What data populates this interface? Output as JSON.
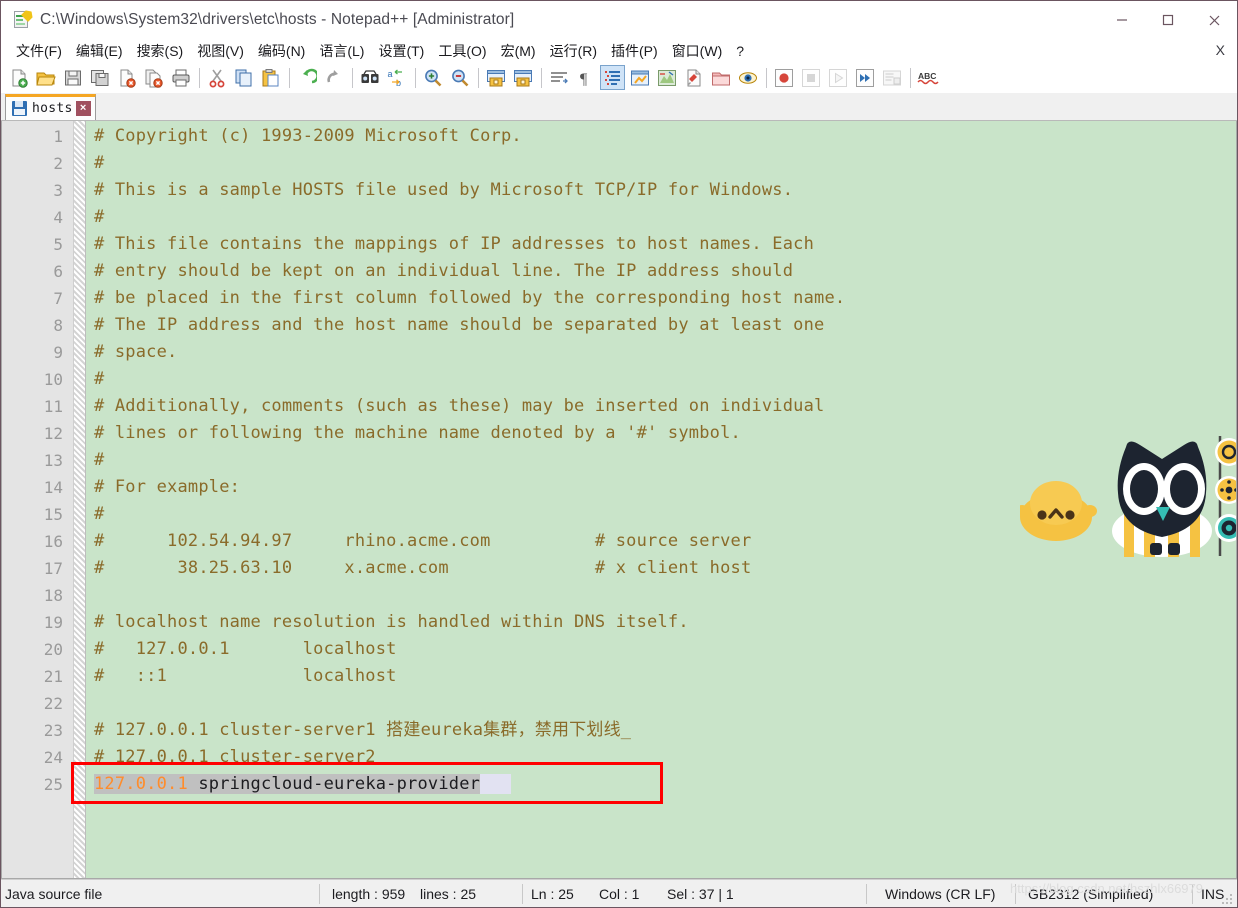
{
  "window": {
    "title": "C:\\Windows\\System32\\drivers\\etc\\hosts - Notepad++ [Administrator]",
    "app_icon": "notepad-plus-plus-icon",
    "controls": {
      "minimize": "minimize-icon",
      "maximize": "maximize-icon",
      "close": "close-icon"
    }
  },
  "menu": {
    "items": [
      {
        "label": "文件(F)",
        "name": "menu-file"
      },
      {
        "label": "编辑(E)",
        "name": "menu-edit"
      },
      {
        "label": "搜索(S)",
        "name": "menu-search"
      },
      {
        "label": "视图(V)",
        "name": "menu-view"
      },
      {
        "label": "编码(N)",
        "name": "menu-encoding"
      },
      {
        "label": "语言(L)",
        "name": "menu-language"
      },
      {
        "label": "设置(T)",
        "name": "menu-settings"
      },
      {
        "label": "工具(O)",
        "name": "menu-tools"
      },
      {
        "label": "宏(M)",
        "name": "menu-macro"
      },
      {
        "label": "运行(R)",
        "name": "menu-run"
      },
      {
        "label": "插件(P)",
        "name": "menu-plugins"
      },
      {
        "label": "窗口(W)",
        "name": "menu-window"
      },
      {
        "label": "?",
        "name": "menu-help"
      }
    ],
    "close_document_label": "X"
  },
  "toolbar": {
    "buttons": [
      "new-file-icon",
      "open-file-icon",
      "save-icon",
      "save-all-icon",
      "close-file-icon",
      "close-all-files-icon",
      "print-icon",
      "cut-icon",
      "copy-icon",
      "paste-icon",
      "undo-icon",
      "redo-icon",
      "find-icon",
      "replace-icon",
      "zoom-in-icon",
      "zoom-out-icon",
      "sync-vertical-scroll-icon",
      "sync-horizontal-scroll-icon",
      "word-wrap-icon",
      "show-all-characters-icon",
      "indent-guide-icon",
      "user-defined-language-icon",
      "document-map-icon",
      "function-list-icon",
      "folder-as-workspace-icon",
      "monitoring-icon",
      "record-macro-icon",
      "stop-recording-icon",
      "play-macro-icon",
      "run-macro-multiple-icon",
      "save-macro-icon",
      "spell-check-icon"
    ],
    "active_button": "show-all-characters-icon"
  },
  "tabs": [
    {
      "label": "hosts",
      "icon": "saved-file-icon",
      "close": "×",
      "active": true
    }
  ],
  "editor": {
    "lines": [
      {
        "n": 1,
        "text": "# Copyright (c) 1993-2009 Microsoft Corp."
      },
      {
        "n": 2,
        "text": "#"
      },
      {
        "n": 3,
        "text": "# This is a sample HOSTS file used by Microsoft TCP/IP for Windows."
      },
      {
        "n": 4,
        "text": "#"
      },
      {
        "n": 5,
        "text": "# This file contains the mappings of IP addresses to host names. Each"
      },
      {
        "n": 6,
        "text": "# entry should be kept on an individual line. The IP address should"
      },
      {
        "n": 7,
        "text": "# be placed in the first column followed by the corresponding host name."
      },
      {
        "n": 8,
        "text": "# The IP address and the host name should be separated by at least one"
      },
      {
        "n": 9,
        "text": "# space."
      },
      {
        "n": 10,
        "text": "#"
      },
      {
        "n": 11,
        "text": "# Additionally, comments (such as these) may be inserted on individual"
      },
      {
        "n": 12,
        "text": "# lines or following the machine name denoted by a '#' symbol."
      },
      {
        "n": 13,
        "text": "#"
      },
      {
        "n": 14,
        "text": "# For example:"
      },
      {
        "n": 15,
        "text": "#"
      },
      {
        "n": 16,
        "text": "#      102.54.94.97     rhino.acme.com          # source server"
      },
      {
        "n": 17,
        "text": "#       38.25.63.10     x.acme.com              # x client host"
      },
      {
        "n": 18,
        "text": ""
      },
      {
        "n": 19,
        "text": "# localhost name resolution is handled within DNS itself."
      },
      {
        "n": 20,
        "text": "#   127.0.0.1       localhost"
      },
      {
        "n": 21,
        "text": "#   ::1             localhost"
      },
      {
        "n": 22,
        "text": ""
      },
      {
        "n": 23,
        "text": "# 127.0.0.1 cluster-server1 搭建eureka集群，禁用下划线_"
      },
      {
        "n": 24,
        "text": "# 127.0.0.1 cluster-server2"
      },
      {
        "n": 25,
        "text": "",
        "ip": "127.0.0.1",
        "host": " springcloud-eureka-provider",
        "selected": true
      }
    ],
    "colors": {
      "background": "#c9e4c9",
      "comment": "#8a6b2a",
      "ip_value": "#ff8c2b",
      "hostname": "#1b1b1f",
      "selection": "#c0c0c0",
      "gutter_bg": "#e4e4e4",
      "line_number": "#9a9a9a",
      "annotation_box": "#ff0000"
    }
  },
  "statusbar": {
    "doc_type": "Java source file",
    "length_label": "length : 959",
    "lines_label": "lines : 25",
    "ln_label": "Ln : 25",
    "col_label": "Col : 1",
    "sel_label": "Sel : 37 | 1",
    "eol": "Windows (CR LF)",
    "encoding": "GB2312 (Simplified)",
    "insert_mode": "INS",
    "watermark": "https://blog.csdn.net/hszhlx66979"
  },
  "mascot": {
    "name": "owl-mascot",
    "companion": "small-yellow-creature",
    "colors": {
      "owl_body": "#1d2430",
      "owl_ears": "#b9cc4f",
      "owl_belly": "#f5c242",
      "owl_beak": "#35bdb4",
      "companion": "#f5c242"
    },
    "rail_icons": [
      "ring-icon",
      "gear-dot-icon",
      "cog-icon"
    ]
  }
}
